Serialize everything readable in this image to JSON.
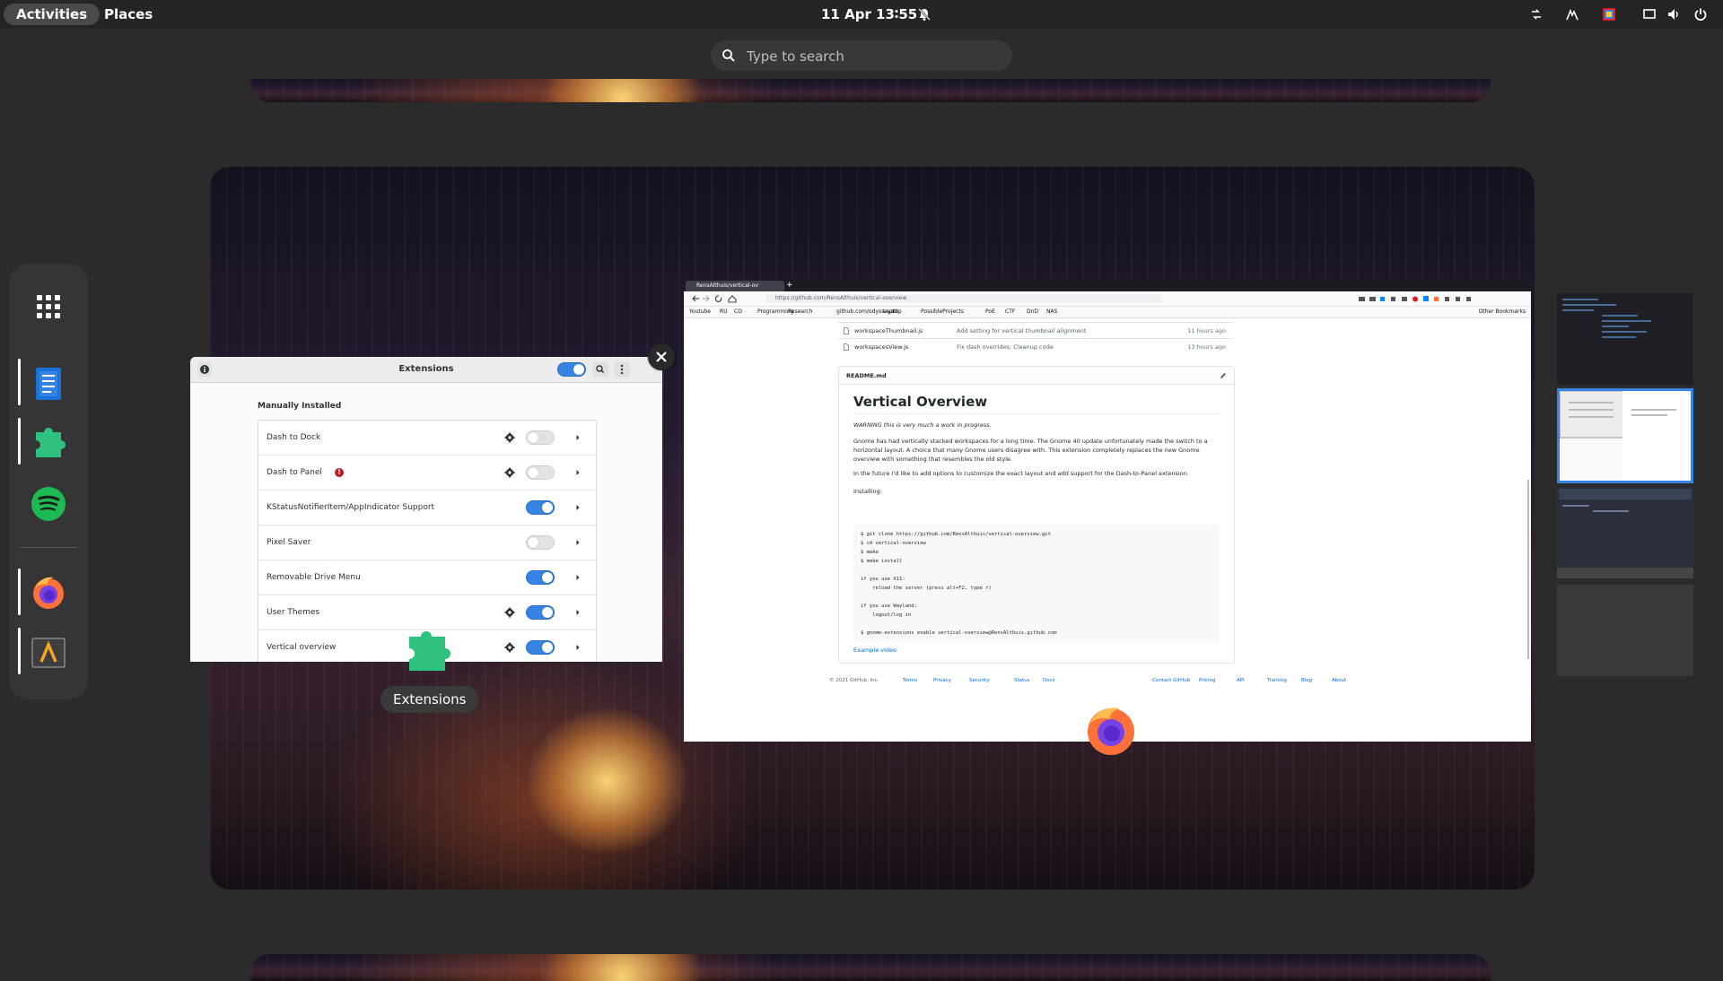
{
  "topbar": {
    "activities": "Activities",
    "places": "Places",
    "datetime": "11 Apr  13∶55",
    "tray_icons": [
      "network-icon",
      "wifi-icon",
      "color-picker-icon",
      "screen-icon",
      "volume-icon",
      "power-icon"
    ]
  },
  "search": {
    "placeholder": "Type to search"
  },
  "dash": {
    "items": [
      {
        "name": "Show Applications",
        "icon": "app-grid-icon"
      },
      {
        "name": "Text Editor",
        "icon": "text-editor-icon",
        "running": true
      },
      {
        "name": "Extensions",
        "icon": "puzzle-icon",
        "running": true
      },
      {
        "name": "Spotify",
        "icon": "spotify-icon"
      },
      {
        "name": "Firefox",
        "icon": "firefox-icon",
        "running": true
      },
      {
        "name": "Alacritty",
        "icon": "terminal-icon",
        "running": true
      }
    ]
  },
  "extensions_window": {
    "title": "Extensions",
    "section": "Manually Installed",
    "master_toggle": true,
    "items": [
      {
        "name": "Dash to Dock",
        "settings": true,
        "enabled": false,
        "error": false
      },
      {
        "name": "Dash to Panel",
        "settings": true,
        "enabled": false,
        "error": true
      },
      {
        "name": "KStatusNotifierItem/AppIndicator Support",
        "settings": false,
        "enabled": true,
        "error": false
      },
      {
        "name": "Pixel Saver",
        "settings": false,
        "enabled": false,
        "error": false
      },
      {
        "name": "Removable Drive Menu",
        "settings": false,
        "enabled": true,
        "error": false
      },
      {
        "name": "User Themes",
        "settings": true,
        "enabled": true,
        "error": false
      },
      {
        "name": "Vertical overview",
        "settings": true,
        "enabled": true,
        "error": false
      }
    ]
  },
  "app_label": "Extensions",
  "browser": {
    "tab_title": "RensAlthuis/vertical-ov",
    "url": "https://github.com/RensAlthuis/vertical-overview",
    "bookmarks": [
      "Youtube",
      "RU",
      "CO",
      "Programming",
      "Research",
      "github.com/odysseyatt..",
      "Laptop",
      "PossibleProjects",
      "PoE",
      "CTF",
      "DnD",
      "NAS"
    ],
    "other_bookmarks": "Other Bookmarks",
    "files": [
      {
        "name": "workspaceThumbnail.js",
        "message": "Add setting for vertical thumbnail alignment",
        "age": "11 hours ago"
      },
      {
        "name": "workspacesView.js",
        "message": "Fix dash overrides; Cleanup code",
        "age": "13 hours ago"
      }
    ],
    "readme": {
      "file": "README.md",
      "title": "Vertical Overview",
      "warning": "WARNING this is very much a work in progress.",
      "para1": "Gnome has had vertically stacked workspaces for a long time. The Gnome 40 update unfortunately made the switch to a horizontal layout. A choice that many Gnome users disagree with. This extension completely replaces the new Gnome overview with something that resembles the old style.",
      "para2": "In the future I'd like to add options to customize the exact layout and add support for the Dash-to-Panel extension.",
      "installing": "Installing:",
      "code": "$ git clone https://github.com/RensAlthuis/vertical-overview.git\n$ cd vertical-overview\n$ make\n$ make install\n\nif you use X11:\n    reload the server (press alt+F2, type r)\n\nif you use Wayland:\n    logout/log in\n\n$ gnome-extensions enable vertical-overview@RensAlthuis.github.com",
      "link": "Example video"
    },
    "footer": [
      "© 2021 GitHub, Inc.",
      "Terms",
      "Privacy",
      "Security",
      "Status",
      "Docs",
      "Contact GitHub",
      "Pricing",
      "API",
      "Training",
      "Blog",
      "About"
    ]
  },
  "colors": {
    "accent": "#3584e4",
    "extension_green": "#2ec27e",
    "spotify_green": "#1db954",
    "topbar": "#252525"
  }
}
